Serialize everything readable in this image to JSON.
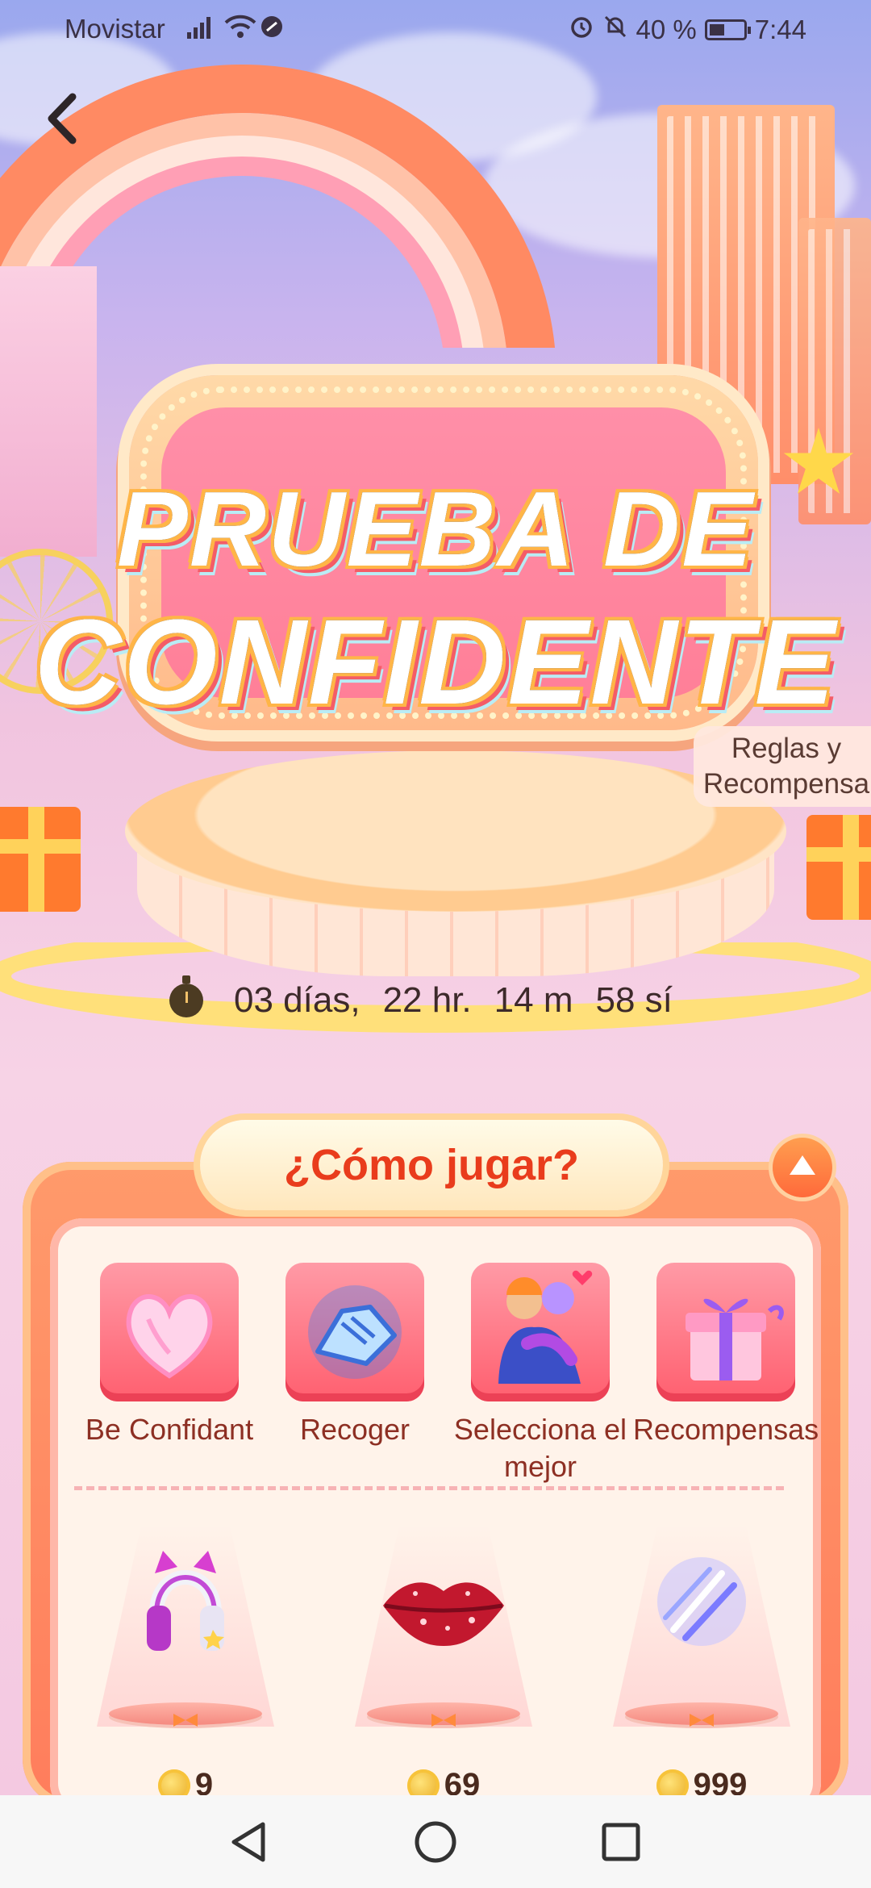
{
  "status_bar": {
    "carrier": "Movistar",
    "battery": "40 %",
    "time": "7:44"
  },
  "event": {
    "title_line1": "PRUEBA DE",
    "title_line2": "CONFIDENTE",
    "rules_line1": "Reglas y",
    "rules_line2": "Recompensa",
    "countdown": {
      "days": "03 días,",
      "hours": "22 hr.",
      "minutes": "14 m",
      "seconds": "58 sí"
    }
  },
  "how_to": {
    "title": "¿Cómo jugar?",
    "steps": [
      {
        "label": "Be Confidant",
        "icon": "heart-hands-icon"
      },
      {
        "label": "Recoger",
        "icon": "handshake-icon"
      },
      {
        "label": "Selecciona el mejor",
        "icon": "hugging-couple-icon"
      },
      {
        "label": "Recompensas",
        "icon": "gift-box-icon"
      }
    ]
  },
  "rewards": [
    {
      "item": "headphones-icon",
      "price": "9"
    },
    {
      "item": "lips-icon",
      "price": "69"
    },
    {
      "item": "light-streak-icon",
      "price": "999"
    }
  ],
  "colors": {
    "accent_red": "#e93c1c",
    "panel_orange": "#ff8a63",
    "coin_gold": "#e8a61b"
  }
}
